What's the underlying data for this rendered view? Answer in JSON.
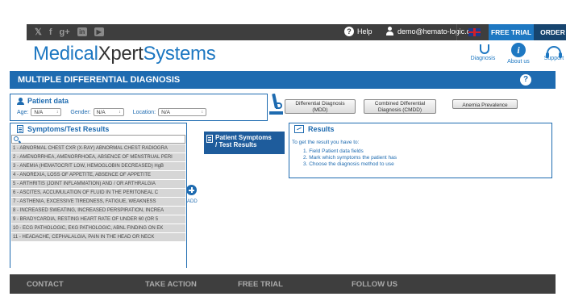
{
  "topbar": {
    "social_icons": [
      "twitter-icon",
      "facebook-icon",
      "google-plus-icon",
      "linkedin-icon",
      "youtube-icon"
    ],
    "help_label": "Help",
    "user_email": "demo@hemato-logic.com",
    "free_trial_label": "FREE TRIAL",
    "order_label": "ORDER"
  },
  "logo": {
    "part1": "Medical",
    "part2": "Xpert",
    "part3": "Systems"
  },
  "nav": [
    {
      "label": "Diagnosis",
      "icon": "stethoscope-icon"
    },
    {
      "label": "About us",
      "icon": "info-icon"
    },
    {
      "label": "Support",
      "icon": "headset-icon"
    }
  ],
  "section": {
    "title": "MULTIPLE DIFFERENTIAL DIAGNOSIS"
  },
  "patient": {
    "title": "Patient data",
    "age_label": "Age:",
    "age_value": "N/A",
    "gender_label": "Gender:",
    "gender_value": "N/A",
    "location_label": "Location:",
    "location_value": "N/A"
  },
  "methods": {
    "mdd_line1": "Differential Diagnosis",
    "mdd_line2": "(MDD)",
    "cmdd_line1": "Combined Differential",
    "cmdd_line2": "Diagnosis (CMDD)",
    "anemia": "Anemia Prevalence"
  },
  "symptoms": {
    "title": "Symptoms/Test Results",
    "items": [
      "1 - ABNORMAL CHEST CXR (X-RAY) ABNORMAL CHEST RADIOGRA",
      "2 - AMENORRHEA, AMENORRHOEA, ABSENCE OF MENSTRUAL PERI",
      "3 - ANEMIA (HEMATOCRIT LOW, HEMOGLOBIN DECREASED) HgB",
      "4 - ANOREXIA, LOSS OF APPETITE, ABSENCE OF APPETITE",
      "5 - ARTHRITIS (JOINT INFLAMMATION) AND / OR ARTHRALGIA",
      "6 - ASCITES, ACCUMULATION OF FLUID IN THE PERITONEAL C",
      "7 - ASTHENIA, EXCESSIVE TIREDNESS, FATIGUE, WEAKNESS",
      "8 - INCREASED SWEATING, INCREASED PERSPIRATION, INCREA",
      "9 - BRADYCARDIA, RESTING HEART RATE OF UNDER 60 (OR 5",
      "10 - ECG PATHOLOGIC, EKG PATHOLOGIC, ABNL FINDING ON EK",
      "11 - HEADACHE, CEPHALALGIA, PAIN IN THE HEAD OR NECK"
    ]
  },
  "add_label": "ADD",
  "patient_symptoms": {
    "line1": "Patient Symptoms",
    "line2": "/ Test Results"
  },
  "results": {
    "title": "Results",
    "intro": "To get the result you have to:",
    "steps": [
      "1.  Field Patient data fields",
      "2.  Mark which symptoms the patient has",
      "3.  Choose the diagnosis method to use"
    ]
  },
  "footer": {
    "items": [
      "CONTACT",
      "TAKE ACTION",
      "FREE TRIAL",
      "FOLLOW US"
    ]
  }
}
